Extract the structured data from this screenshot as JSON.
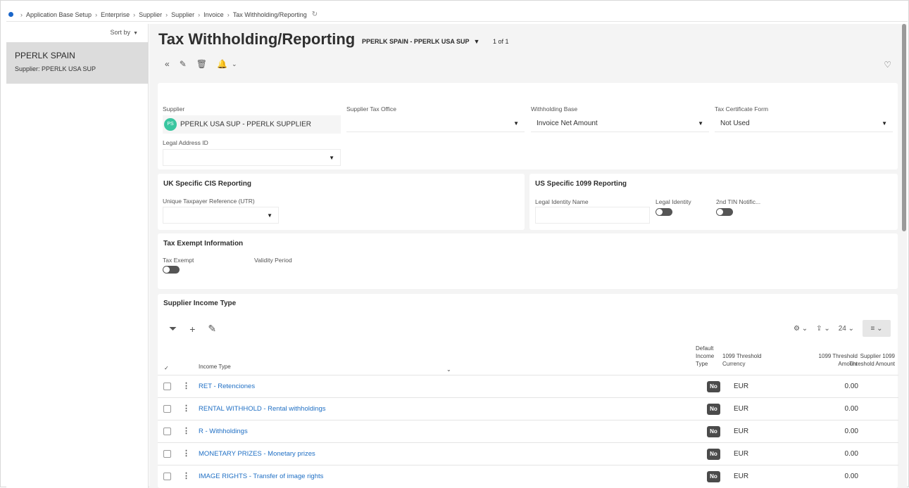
{
  "breadcrumb": [
    "Application Base Setup",
    "Enterprise",
    "Supplier",
    "Supplier",
    "Invoice",
    "Tax Withholding/Reporting"
  ],
  "left_pane": {
    "sort_label": "Sort by",
    "record_title": "PPERLK SPAIN",
    "record_subtitle": "Supplier:  PPERLK USA SUP"
  },
  "page": {
    "title": "Tax Withholding/Reporting",
    "record_selector": "PPERLK SPAIN - PPERLK USA SUP",
    "count": "1 of 1"
  },
  "general": {
    "supplier_label": "Supplier",
    "supplier_avatar": "PS",
    "supplier_value": "PPERLK USA SUP - PPERLK SUPPLIER",
    "tax_office_label": "Supplier Tax Office",
    "tax_office_value": "",
    "withholding_base_label": "Withholding Base",
    "withholding_base_value": "Invoice Net Amount",
    "tax_cert_label": "Tax Certificate Form",
    "tax_cert_value": "Not Used",
    "legal_address_label": "Legal Address ID",
    "legal_address_value": ""
  },
  "uk_cis": {
    "title": "UK Specific CIS Reporting",
    "utr_label": "Unique Taxpayer Reference (UTR)",
    "utr_value": ""
  },
  "us_1099": {
    "title": "US Specific 1099 Reporting",
    "legal_identity_name_label": "Legal Identity Name",
    "legal_identity_label": "Legal Identity",
    "tin_label": "2nd TIN Notific..."
  },
  "tax_exempt": {
    "title": "Tax Exempt Information",
    "tax_exempt_label": "Tax Exempt",
    "validity_label": "Validity Period"
  },
  "income": {
    "title": "Supplier Income Type",
    "page_size": "24",
    "headers": {
      "income_type": "Income Type",
      "default_income_type": [
        "Default",
        "Income",
        "Type"
      ],
      "threshold_currency": [
        "1099 Threshold",
        "Currency"
      ],
      "threshold_amount": [
        "1099 Threshold",
        "Amount"
      ],
      "supplier_threshold": [
        "Supplier 1099",
        "Threshold Amount"
      ]
    },
    "rows": [
      {
        "income_type": "RET - Retenciones",
        "default": "No",
        "currency": "EUR",
        "amount": "0.00"
      },
      {
        "income_type": "RENTAL WITHHOLD - Rental withholdings",
        "default": "No",
        "currency": "EUR",
        "amount": "0.00"
      },
      {
        "income_type": "R - Withholdings",
        "default": "No",
        "currency": "EUR",
        "amount": "0.00"
      },
      {
        "income_type": "MONETARY PRIZES - Monetary prizes",
        "default": "No",
        "currency": "EUR",
        "amount": "0.00"
      },
      {
        "income_type": "IMAGE RIGHTS - Transfer of image rights",
        "default": "No",
        "currency": "EUR",
        "amount": "0.00"
      }
    ]
  }
}
